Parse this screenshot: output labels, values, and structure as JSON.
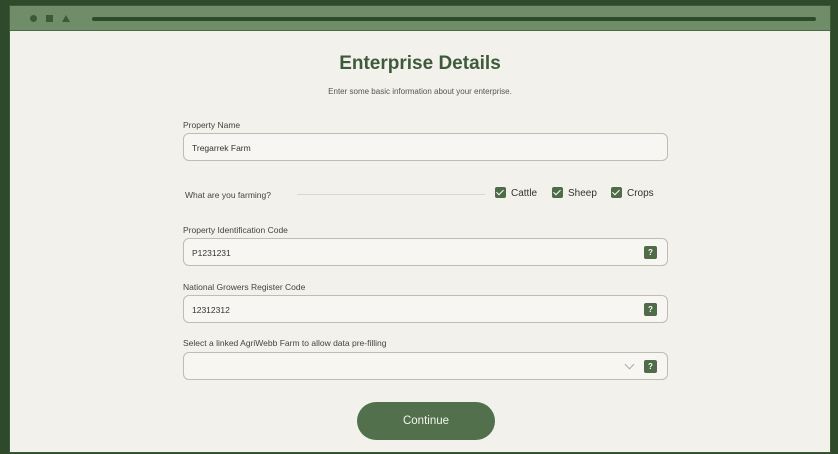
{
  "header": {
    "title": "Enterprise Details",
    "subtitle": "Enter some basic information about your enterprise."
  },
  "property_name": {
    "label": "Property Name",
    "value": "Tregarrek Farm"
  },
  "farming": {
    "question": "What are you farming?",
    "options": [
      {
        "label": "Cattle",
        "checked": true
      },
      {
        "label": "Sheep",
        "checked": true
      },
      {
        "label": "Crops",
        "checked": true
      }
    ]
  },
  "pic": {
    "label": "Property Identification Code",
    "value": "P1231231",
    "help": "?"
  },
  "ngr": {
    "label": "National Growers Register Code",
    "value": "12312312",
    "help": "?"
  },
  "linked_farm": {
    "label": "Select a linked AgriWebb Farm to allow data pre-filling",
    "value": "",
    "help": "?"
  },
  "actions": {
    "continue_label": "Continue"
  },
  "colors": {
    "accent": "#52704c",
    "chrome": "#6f8d68",
    "background": "#2f4a2a"
  }
}
